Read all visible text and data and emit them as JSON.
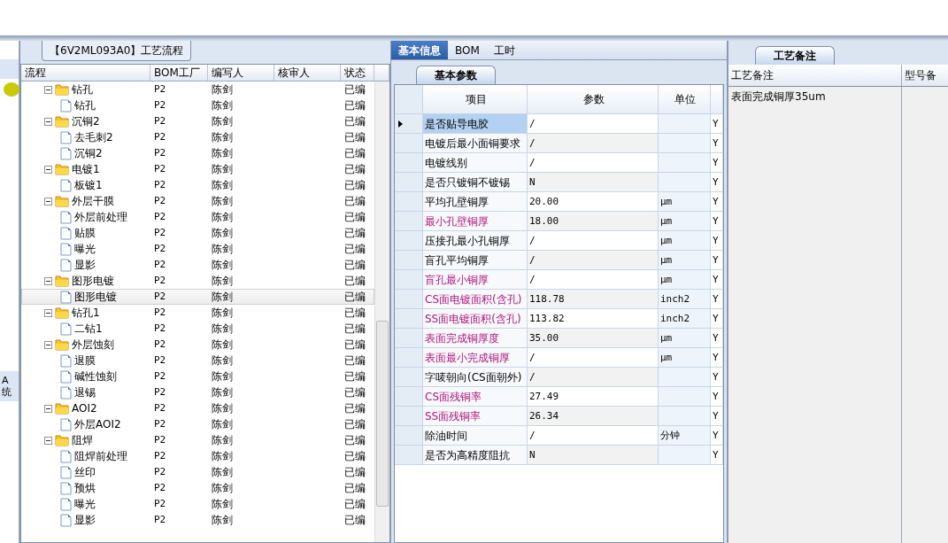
{
  "left_panel": {
    "tab": "【6V2ML093A0】工艺流程",
    "side_label": [
      "A",
      "统"
    ],
    "columns": [
      "流程",
      "BOM工厂",
      "编写人",
      "核审人",
      "状态"
    ],
    "tree": [
      {
        "label": "钻孔",
        "bom": "P2",
        "author": "陈剑",
        "status": "已编",
        "selected": false,
        "children": [
          {
            "label": "钻孔",
            "bom": "P2",
            "author": "陈剑",
            "status": "已编",
            "selected": false
          }
        ]
      },
      {
        "label": "沉铜2",
        "bom": "P2",
        "author": "陈剑",
        "status": "已编",
        "selected": false,
        "children": [
          {
            "label": "去毛刺2",
            "bom": "P2",
            "author": "陈剑",
            "status": "已编",
            "selected": false
          },
          {
            "label": "沉铜2",
            "bom": "P2",
            "author": "陈剑",
            "status": "已编",
            "selected": false
          }
        ]
      },
      {
        "label": "电镀1",
        "bom": "P2",
        "author": "陈剑",
        "status": "已编",
        "selected": false,
        "children": [
          {
            "label": "板镀1",
            "bom": "P2",
            "author": "陈剑",
            "status": "已编",
            "selected": false
          }
        ]
      },
      {
        "label": "外层干膜",
        "bom": "P2",
        "author": "陈剑",
        "status": "已编",
        "selected": false,
        "children": [
          {
            "label": "外层前处理",
            "bom": "P2",
            "author": "陈剑",
            "status": "已编",
            "selected": false
          },
          {
            "label": "贴膜",
            "bom": "P2",
            "author": "陈剑",
            "status": "已编",
            "selected": false
          },
          {
            "label": "曝光",
            "bom": "P2",
            "author": "陈剑",
            "status": "已编",
            "selected": false
          },
          {
            "label": "显影",
            "bom": "P2",
            "author": "陈剑",
            "status": "已编",
            "selected": false
          }
        ]
      },
      {
        "label": "图形电镀",
        "bom": "P2",
        "author": "陈剑",
        "status": "已编",
        "selected": false,
        "children": [
          {
            "label": "图形电镀",
            "bom": "P2",
            "author": "陈剑",
            "status": "已编",
            "selected": true
          }
        ]
      },
      {
        "label": "钻孔1",
        "bom": "P2",
        "author": "陈剑",
        "status": "已编",
        "selected": false,
        "children": [
          {
            "label": "二钻1",
            "bom": "P2",
            "author": "陈剑",
            "status": "已编",
            "selected": false
          }
        ]
      },
      {
        "label": "外层蚀刻",
        "bom": "P2",
        "author": "陈剑",
        "status": "已编",
        "selected": false,
        "children": [
          {
            "label": "退膜",
            "bom": "P2",
            "author": "陈剑",
            "status": "已编",
            "selected": false
          },
          {
            "label": "碱性蚀刻",
            "bom": "P2",
            "author": "陈剑",
            "status": "已编",
            "selected": false
          },
          {
            "label": "退锡",
            "bom": "P2",
            "author": "陈剑",
            "status": "已编",
            "selected": false
          }
        ]
      },
      {
        "label": "AOI2",
        "bom": "P2",
        "author": "陈剑",
        "status": "已编",
        "selected": false,
        "children": [
          {
            "label": "外层AOI2",
            "bom": "P2",
            "author": "陈剑",
            "status": "已编",
            "selected": false
          }
        ]
      },
      {
        "label": "阻焊",
        "bom": "P2",
        "author": "陈剑",
        "status": "已编",
        "selected": false,
        "children": [
          {
            "label": "阻焊前处理",
            "bom": "P2",
            "author": "陈剑",
            "status": "已编",
            "selected": false
          },
          {
            "label": "丝印",
            "bom": "P2",
            "author": "陈剑",
            "status": "已编",
            "selected": false
          },
          {
            "label": "预烘",
            "bom": "P2",
            "author": "陈剑",
            "status": "已编",
            "selected": false
          },
          {
            "label": "曝光",
            "bom": "P2",
            "author": "陈剑",
            "status": "已编",
            "selected": false
          },
          {
            "label": "显影",
            "bom": "P2",
            "author": "陈剑",
            "status": "已编",
            "selected": false
          }
        ]
      }
    ]
  },
  "tabs": [
    {
      "label": "基本信息",
      "selected": true
    },
    {
      "label": "BOM",
      "selected": false
    },
    {
      "label": "工时",
      "selected": false
    }
  ],
  "params": {
    "tab": "基本参数",
    "columns": [
      "项目",
      "参数",
      "单位"
    ],
    "rows": [
      {
        "item": "是否贴导电胶",
        "value": "/",
        "flag": "Y",
        "highlight": false,
        "selected": true
      },
      {
        "item": "电镀后最小面铜要求",
        "value": "/",
        "flag": "Y",
        "highlight": false,
        "selected": false
      },
      {
        "item": "电镀线别",
        "value": "/",
        "flag": "Y",
        "highlight": false,
        "selected": false
      },
      {
        "item": "是否只镀铜不镀锡",
        "value": "N",
        "flag": "Y",
        "highlight": false,
        "selected": false
      },
      {
        "item": "平均孔壁铜厚",
        "value": "20.00",
        "unit": "μm",
        "flag": "Y",
        "highlight": false,
        "selected": false
      },
      {
        "item": "最小孔壁铜厚",
        "value": "18.00",
        "unit": "μm",
        "flag": "Y",
        "highlight": true,
        "selected": false
      },
      {
        "item": "压接孔最小孔铜厚",
        "value": "/",
        "unit": "μm",
        "flag": "Y",
        "highlight": false,
        "selected": false
      },
      {
        "item": "盲孔平均铜厚",
        "value": "/",
        "unit": "μm",
        "flag": "Y",
        "highlight": false,
        "selected": false
      },
      {
        "item": "盲孔最小铜厚",
        "value": "/",
        "unit": "μm",
        "flag": "Y",
        "highlight": true,
        "selected": false
      },
      {
        "item": "CS面电镀面积(含孔)",
        "value": "118.78",
        "unit": "inch2",
        "flag": "Y",
        "highlight": true,
        "selected": false
      },
      {
        "item": "SS面电镀面积(含孔)",
        "value": "113.82",
        "unit": "inch2",
        "flag": "Y",
        "highlight": true,
        "selected": false
      },
      {
        "item": "表面完成铜厚度",
        "value": "35.00",
        "unit": "μm",
        "flag": "Y",
        "highlight": true,
        "selected": false
      },
      {
        "item": "表面最小完成铜厚",
        "value": "/",
        "unit": "μm",
        "flag": "Y",
        "highlight": true,
        "selected": false
      },
      {
        "item": "字唛朝向(CS面朝外)",
        "value": "/",
        "flag": "Y",
        "highlight": false,
        "selected": false
      },
      {
        "item": "CS面残铜率",
        "value": "27.49",
        "flag": "Y",
        "highlight": true,
        "selected": false
      },
      {
        "item": "SS面残铜率",
        "value": "26.34",
        "flag": "Y",
        "highlight": true,
        "selected": false
      },
      {
        "item": "除油时间",
        "value": "/",
        "unit": "分钟",
        "flag": "Y",
        "highlight": false,
        "selected": false
      },
      {
        "item": "是否为高精度阻抗",
        "value": "N",
        "flag": "Y",
        "highlight": false,
        "selected": false
      }
    ]
  },
  "notes": {
    "tab": "工艺备注",
    "columns": [
      "工艺备注",
      "型号备"
    ],
    "text": "表面完成铜厚35um"
  }
}
